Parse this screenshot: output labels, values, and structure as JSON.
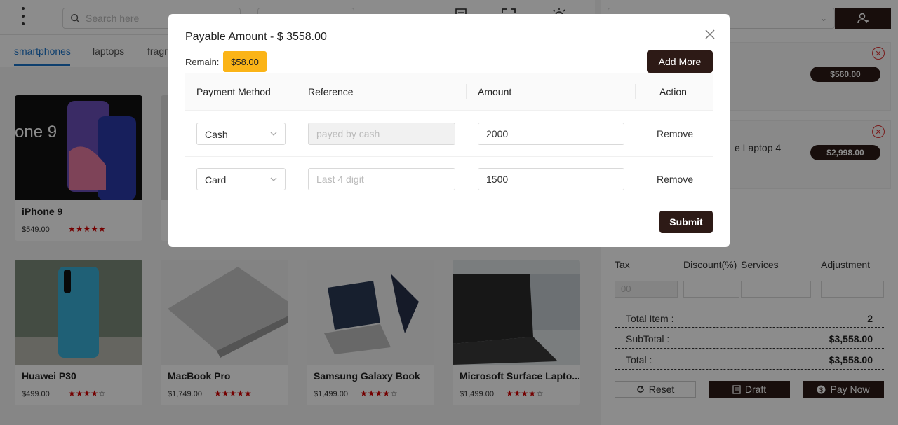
{
  "topbar": {
    "search_placeholder": "Search here"
  },
  "categories": [
    "smartphones",
    "laptops",
    "fragr"
  ],
  "products": [
    {
      "name": "iPhone 9",
      "price": "$549.00",
      "stars": 5
    },
    {
      "name": "Huawei P30",
      "price": "$499.00",
      "stars": 4
    },
    {
      "name": "MacBook Pro",
      "price": "$1,749.00",
      "stars": 5
    },
    {
      "name": "Samsung Galaxy Book",
      "price": "$1,499.00",
      "stars": 4
    },
    {
      "name": "Microsoft Surface Lapto...",
      "price": "$1,499.00",
      "stars": 4
    }
  ],
  "cart": {
    "items": [
      {
        "title": "",
        "price": "$560.00"
      },
      {
        "title": "e Laptop 4",
        "price": "$2,998.00"
      }
    ],
    "labels": {
      "tax": "Tax",
      "discount": "Discount(%)",
      "services": "Services",
      "adjustment": "Adjustment"
    },
    "tax_value": "00",
    "summary": [
      {
        "label": "Total Item :",
        "value": "2"
      },
      {
        "label": "SubTotal :",
        "value": "$3,558.00"
      },
      {
        "label": "Total :",
        "value": "$3,558.00"
      }
    ],
    "buttons": {
      "reset": "Reset",
      "draft": "Draft",
      "pay_now": "Pay Now"
    }
  },
  "modal": {
    "title": "Payable Amount - $ 3558.00",
    "remain_label": "Remain:",
    "remain_value": "$58.00",
    "add_more": "Add More",
    "columns": [
      "Payment Method",
      "Reference",
      "Amount",
      "Action"
    ],
    "rows": [
      {
        "method": "Cash",
        "reference_value": "",
        "reference_placeholder": "payed by cash",
        "reference_disabled": true,
        "amount": "2000",
        "action": "Remove"
      },
      {
        "method": "Card",
        "reference_value": "",
        "reference_placeholder": "Last 4 digit",
        "reference_disabled": false,
        "amount": "1500",
        "action": "Remove"
      }
    ],
    "submit": "Submit"
  },
  "colors": {
    "brand_dark": "#2d1a16",
    "remain_badge": "#fbb417",
    "active_tab": "#1a73c9",
    "star": "#d40000"
  }
}
